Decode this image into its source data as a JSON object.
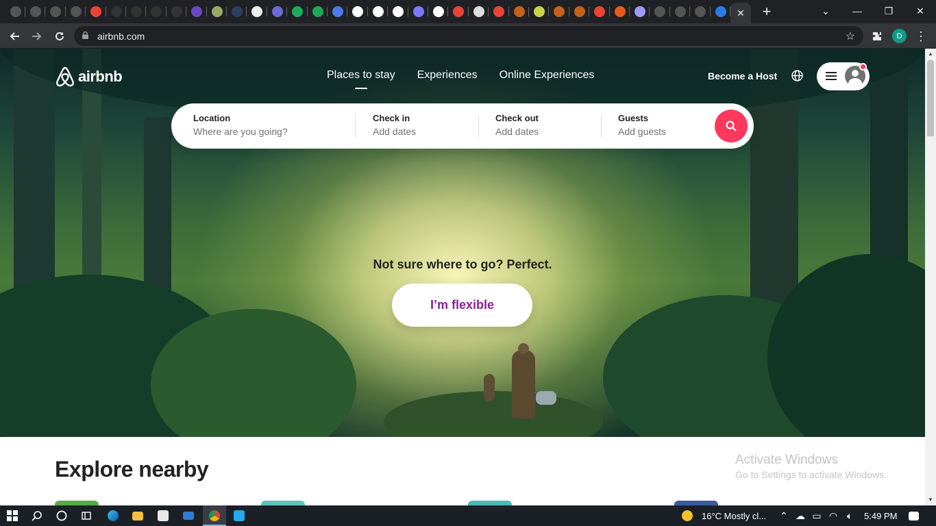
{
  "browser": {
    "tabs_count": 36,
    "active_tab_close": "✕",
    "new_tab": "+",
    "url": "airbnb.com",
    "profile_initial": "D",
    "window_controls": [
      "⌄",
      "—",
      "❐",
      "✕"
    ]
  },
  "site": {
    "logo_text": "airbnb",
    "nav": [
      "Places to stay",
      "Experiences",
      "Online Experiences"
    ],
    "become_host": "Become a Host",
    "search": {
      "location_label": "Location",
      "location_placeholder": "Where are you going?",
      "checkin_label": "Check in",
      "checkin_value": "Add dates",
      "checkout_label": "Check out",
      "checkout_value": "Add dates",
      "guests_label": "Guests",
      "guests_value": "Add guests"
    },
    "tagline": "Not sure where to go? Perfect.",
    "cta": "I’m flexible",
    "explore_heading": "Explore nearby",
    "brand_color": "#ff385c",
    "cta_color": "#8b1d9b"
  },
  "watermark": {
    "line1": "Activate Windows",
    "line2": "Go to Settings to activate Windows."
  },
  "taskbar": {
    "weather": "16°C  Mostly cl...",
    "time": "5:49 PM"
  }
}
